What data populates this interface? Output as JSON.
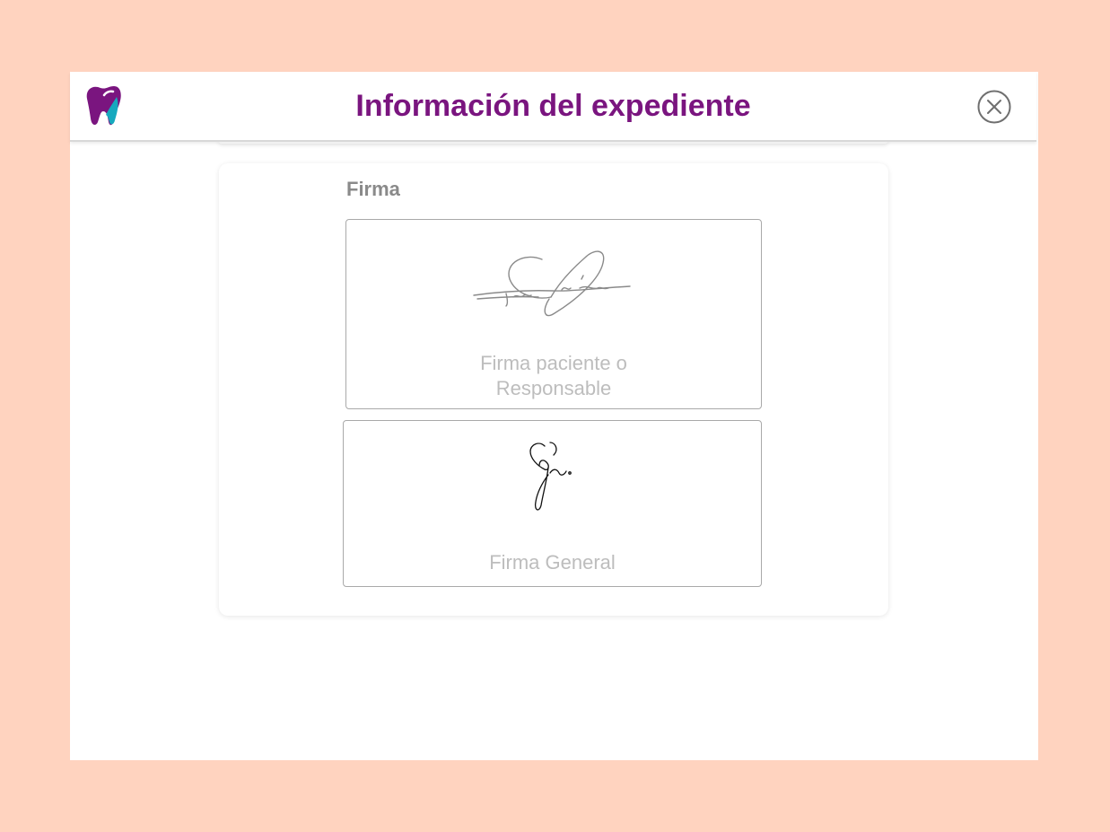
{
  "header": {
    "title": "Información del expediente",
    "logo_icon": "tooth-logo-icon",
    "close_icon": "close-circle-icon"
  },
  "firma_section": {
    "label": "Firma",
    "signatures": [
      {
        "caption": "Firma paciente o\nResponsable",
        "image": "handwritten-signature"
      },
      {
        "caption": "Firma General",
        "image": "handwritten-signature"
      }
    ]
  },
  "colors": {
    "background": "#ffd3bf",
    "title": "#7a157f",
    "logo_primary": "#7a157f",
    "logo_accent": "#16a9be",
    "caption": "#bdbdbd",
    "section_label": "#8a8a8a"
  }
}
